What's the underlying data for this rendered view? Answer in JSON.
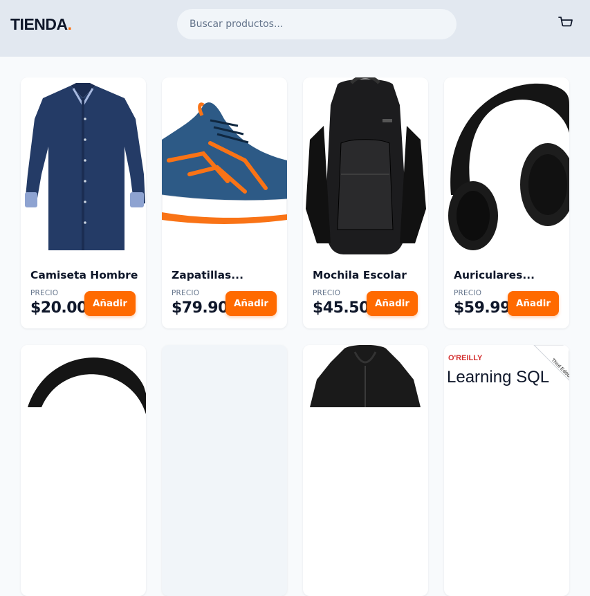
{
  "header": {
    "logo_text": "TIENDA",
    "logo_dot": ".",
    "search_placeholder": "Buscar productos...",
    "cart_icon": "shopping-cart-icon"
  },
  "colors": {
    "accent": "#ff6a00",
    "header_bg": "#e2e8f0",
    "page_bg": "#f8fafc"
  },
  "products": [
    {
      "name": "Camiseta Hombre",
      "price_label": "PRECIO",
      "price": "$20.00",
      "button": "Añadir",
      "image": "navy-shirt"
    },
    {
      "name": "Zapatillas...",
      "price_label": "PRECIO",
      "price": "$79.90",
      "button": "Añadir",
      "image": "running-shoe"
    },
    {
      "name": "Mochila Escolar",
      "price_label": "PRECIO",
      "price": "$45.50",
      "button": "Añadir",
      "image": "black-backpack"
    },
    {
      "name": "Auriculares...",
      "price_label": "PRECIO",
      "price": "$59.99",
      "button": "Añadir",
      "image": "black-headphones"
    }
  ],
  "second_row": [
    {
      "image": "black-headphones"
    },
    {
      "image": "loading-placeholder"
    },
    {
      "image": "black-jacket"
    },
    {
      "image": "oreilly-book",
      "book_publisher": "O'REILLY",
      "book_title": "Learning SQL",
      "book_badge": "Third Edition"
    }
  ]
}
